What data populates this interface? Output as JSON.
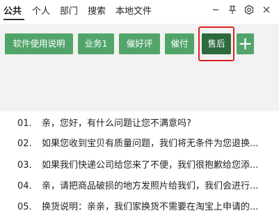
{
  "tabs": [
    "公共",
    "个人",
    "部门",
    "搜索",
    "本地文件"
  ],
  "active_tab": "公共",
  "window_controls": {
    "minimize_icon": "minimize-icon",
    "pin_icon": "pin-icon",
    "settings_icon": "gear-icon",
    "close_icon": "close-icon"
  },
  "buttons": [
    "软件使用说明",
    "业务1",
    "催好评",
    "催付",
    "售后"
  ],
  "selected_button": "售后",
  "add_button_icon": "plus-icon",
  "colors": {
    "button_green": "#52a56a",
    "button_selected": "#2d6a3d",
    "highlight_red": "#e0201c",
    "toolbar_bg": "#f2f2f2"
  },
  "items": [
    {
      "num": "01.",
      "text": "亲，您好，有什么问题让您不满意吗?"
    },
    {
      "num": "02.",
      "text": "如果您收到宝贝有质量问题，我们将无条件为您退换..."
    },
    {
      "num": "03.",
      "text": "如果我们快递公司给您来了不便，我们很抱歉给您添..."
    },
    {
      "num": "04.",
      "text": "亲，请把商品破损的地方发照片给我们，我们会进行..."
    },
    {
      "num": "05.",
      "text": "换货说明：亲亲，我们家换货不需要在淘宝上申请的..."
    }
  ]
}
